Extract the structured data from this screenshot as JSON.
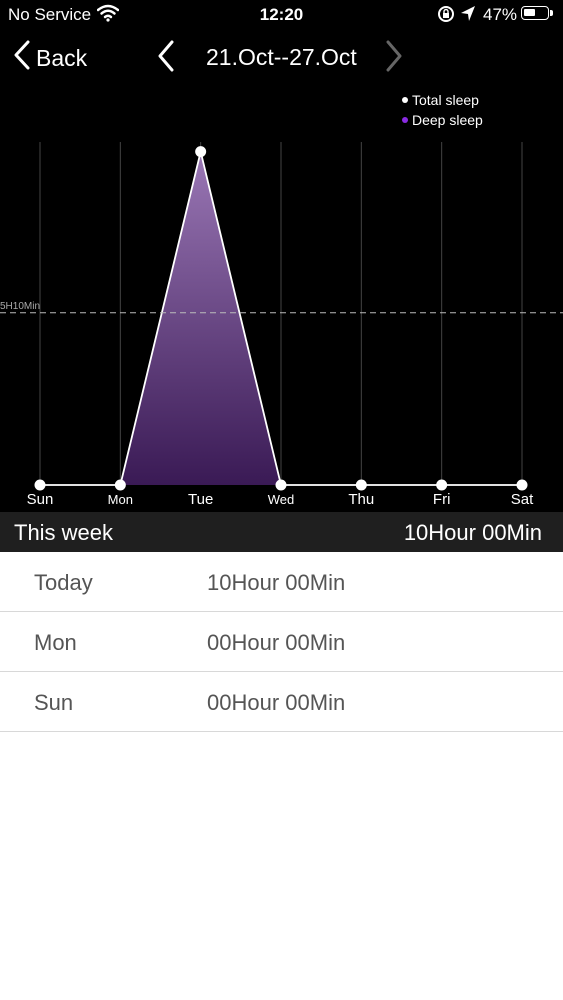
{
  "status_bar": {
    "carrier": "No Service",
    "time": "12:20",
    "battery": "47%"
  },
  "nav": {
    "back_label": "Back",
    "date_range": "21.Oct--27.Oct"
  },
  "legend": {
    "total_label": "Total sleep",
    "deep_label": "Deep sleep",
    "total_color": "#ffffff",
    "deep_color": "#8a2be2"
  },
  "chart_data": {
    "type": "area",
    "categories": [
      "Sun",
      "Mon",
      "Tue",
      "Wed",
      "Thu",
      "Fri",
      "Sat"
    ],
    "series": [
      {
        "values": [
          0,
          0,
          600,
          0,
          0,
          0,
          0
        ]
      }
    ],
    "reference_line": {
      "label": "5H10Min",
      "value": 310
    },
    "ylim": [
      0,
      720
    ],
    "grid": true
  },
  "week": {
    "label": "This week",
    "total": "10Hour 00Min"
  },
  "days": [
    {
      "day": "Today",
      "duration": "10Hour 00Min"
    },
    {
      "day": "Mon",
      "duration": "00Hour 00Min"
    },
    {
      "day": "Sun",
      "duration": "00Hour 00Min"
    }
  ]
}
